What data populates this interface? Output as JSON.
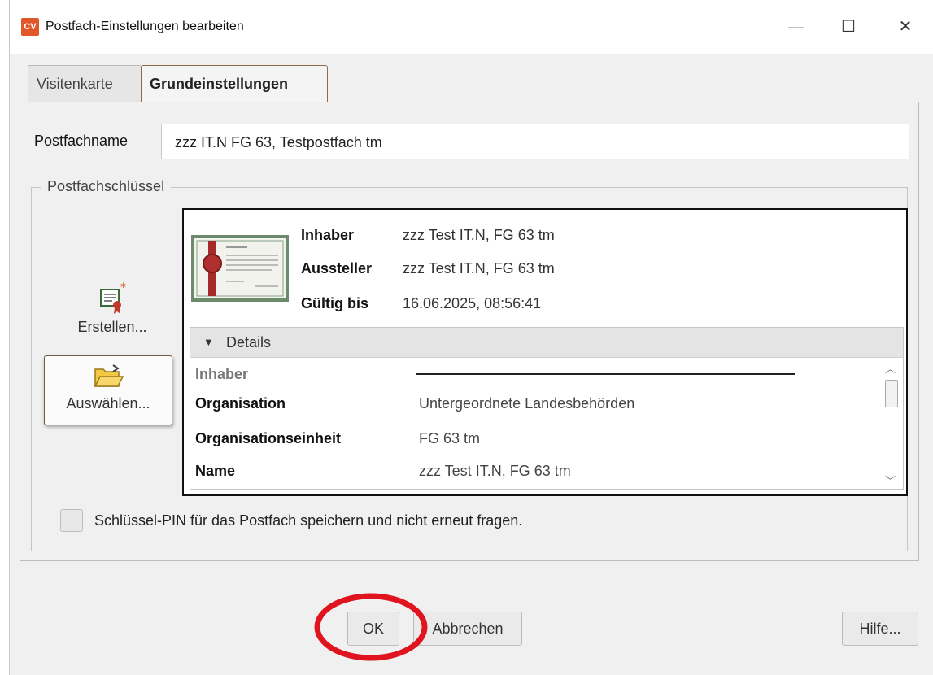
{
  "window": {
    "icon_text": "CV",
    "title": "Postfach-Einstellungen bearbeiten",
    "controls": {
      "minimize": "—",
      "maximize": "☐",
      "close": "✕"
    }
  },
  "tabs": [
    {
      "label": "Visitenkarte",
      "active": false
    },
    {
      "label": "Grundeinstellungen",
      "active": true
    }
  ],
  "mailbox": {
    "name_label": "Postfachname",
    "name_value": "zzz IT.N FG 63, Testpostfach tm"
  },
  "key_group": {
    "label": "Postfachschlüssel",
    "create_label": "Erstellen...",
    "select_label": "Auswählen...",
    "create_icon": "certificate-new-icon",
    "select_icon": "open-folder-icon"
  },
  "certificate": {
    "image_icon": "certificate-image-icon",
    "fields": [
      {
        "label": "Inhaber",
        "value": "zzz Test IT.N, FG 63 tm"
      },
      {
        "label": "Aussteller",
        "value": "zzz Test IT.N, FG 63 tm"
      },
      {
        "label": "Gültig bis",
        "value": "16.06.2025, 08:56:41"
      }
    ],
    "details": {
      "header": "Details",
      "section_label": "Inhaber",
      "rows": [
        {
          "label": "Organisation",
          "value": "Untergeordnete Landesbehörden"
        },
        {
          "label": "Organisationseinheit",
          "value": "FG 63 tm"
        },
        {
          "label": "Name",
          "value": "zzz Test IT.N, FG 63 tm"
        }
      ]
    }
  },
  "save_pin": {
    "checked": false,
    "label": "Schlüssel-PIN für das Postfach speichern und nicht erneut fragen."
  },
  "buttons": {
    "ok": "OK",
    "cancel": "Abbrechen",
    "help": "Hilfe..."
  },
  "colors": {
    "app_icon": "#e2572a",
    "active_tab_border": "#8c6a4e",
    "annotation_circle": "#e0141e"
  }
}
